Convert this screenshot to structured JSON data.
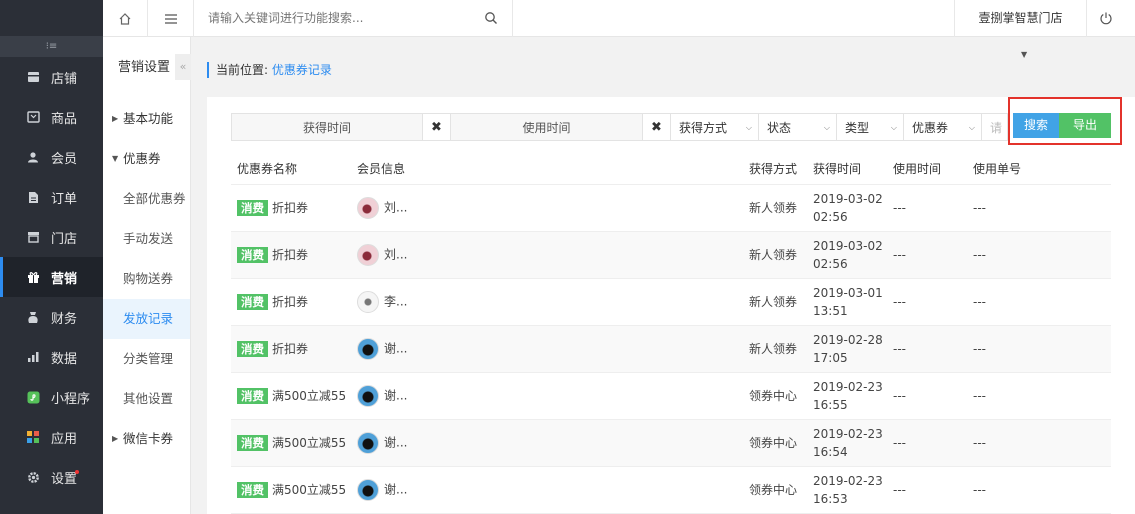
{
  "sidebar": {
    "items": [
      {
        "label": "店铺",
        "icon": "store-icon"
      },
      {
        "label": "商品",
        "icon": "goods-icon"
      },
      {
        "label": "会员",
        "icon": "member-icon"
      },
      {
        "label": "订单",
        "icon": "order-icon"
      },
      {
        "label": "门店",
        "icon": "shop-icon"
      },
      {
        "label": "营销",
        "icon": "gift-icon"
      },
      {
        "label": "财务",
        "icon": "finance-icon"
      },
      {
        "label": "数据",
        "icon": "chart-icon"
      },
      {
        "label": "小程序",
        "icon": "miniprogram-icon"
      },
      {
        "label": "应用",
        "icon": "apps-icon"
      },
      {
        "label": "设置",
        "icon": "gear-icon"
      }
    ],
    "active_index": 5
  },
  "topbar": {
    "search_placeholder": "请输入关键词进行功能搜索...",
    "shop_name": "壹捌掌智慧门店"
  },
  "subnav": {
    "title": "营销设置",
    "group1": "基本功能",
    "group2": "优惠券",
    "items": [
      "全部优惠券",
      "手动发送",
      "购物送券",
      "发放记录",
      "分类管理",
      "其他设置"
    ],
    "group3": "微信卡券"
  },
  "breadcrumb": {
    "label": "当前位置:",
    "current": "优惠券记录"
  },
  "filters": {
    "get_time": "获得时间",
    "use_time": "使用时间",
    "get_method": "获得方式",
    "status": "状态",
    "type": "类型",
    "coupon": "优惠券",
    "extra": "请",
    "search_btn": "搜索",
    "export_btn": "导出"
  },
  "table": {
    "headers": [
      "优惠券名称",
      "会员信息",
      "获得方式",
      "获得时间",
      "使用时间",
      "使用单号"
    ],
    "tag": "消费",
    "rows": [
      {
        "name": "折扣券",
        "member": "刘...",
        "avatar": "av-a",
        "method": "新人领券",
        "date": "2019-03-02",
        "time": "02:56",
        "use_time": "---",
        "use_no": "---"
      },
      {
        "name": "折扣券",
        "member": "刘...",
        "avatar": "av-a",
        "method": "新人领券",
        "date": "2019-03-02",
        "time": "02:56",
        "use_time": "---",
        "use_no": "---"
      },
      {
        "name": "折扣券",
        "member": "李...",
        "avatar": "av-b",
        "method": "新人领券",
        "date": "2019-03-01",
        "time": "13:51",
        "use_time": "---",
        "use_no": "---"
      },
      {
        "name": "折扣券",
        "member": "谢...",
        "avatar": "av-c",
        "method": "新人领券",
        "date": "2019-02-28",
        "time": "17:05",
        "use_time": "---",
        "use_no": "---"
      },
      {
        "name": "满500立减55",
        "member": "谢...",
        "avatar": "av-c",
        "method": "领券中心",
        "date": "2019-02-23",
        "time": "16:55",
        "use_time": "---",
        "use_no": "---"
      },
      {
        "name": "满500立减55",
        "member": "谢...",
        "avatar": "av-c",
        "method": "领券中心",
        "date": "2019-02-23",
        "time": "16:54",
        "use_time": "---",
        "use_no": "---"
      },
      {
        "name": "满500立减55",
        "member": "谢...",
        "avatar": "av-c",
        "method": "领券中心",
        "date": "2019-02-23",
        "time": "16:53",
        "use_time": "---",
        "use_no": "---"
      }
    ]
  }
}
